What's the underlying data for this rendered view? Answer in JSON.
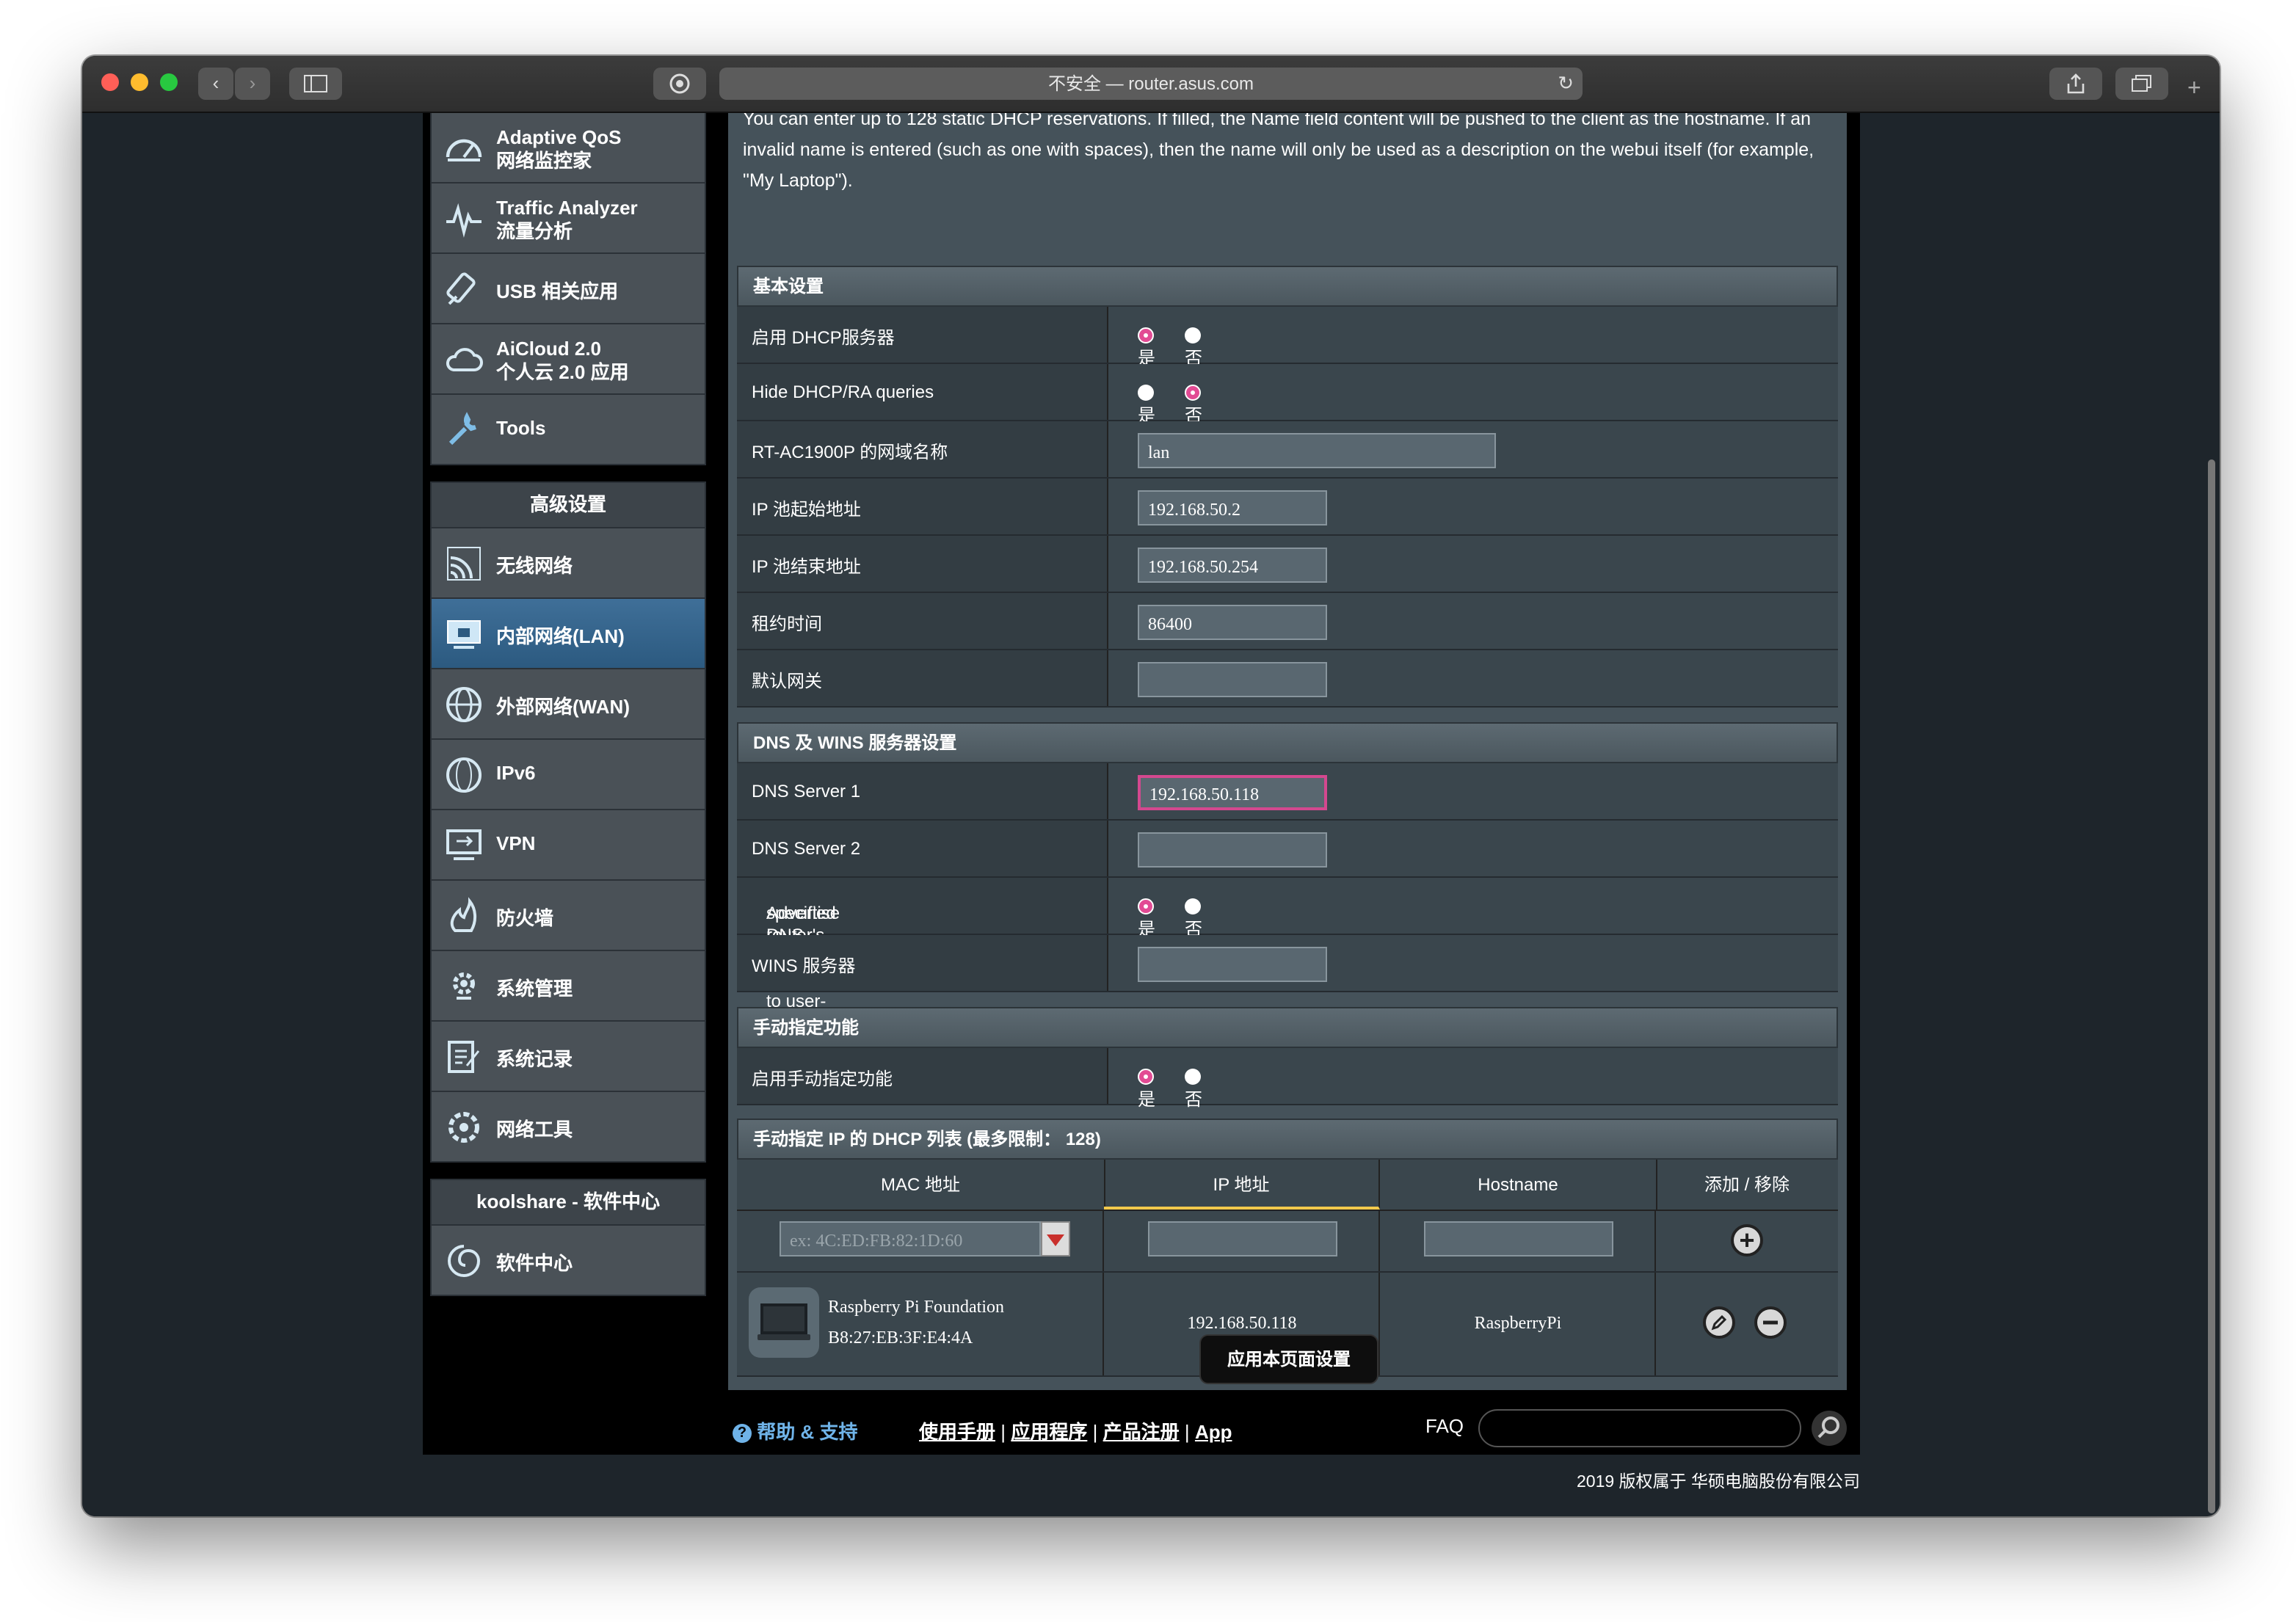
{
  "browser": {
    "url_text": "不安全 — router.asus.com",
    "reload_glyph": "↻"
  },
  "sidebar": {
    "general_items": [
      {
        "label_1": "Adaptive QoS",
        "label_2": "网络监控家",
        "icon": "gauge-icon"
      },
      {
        "label_1": "Traffic Analyzer",
        "label_2": "流量分析",
        "icon": "pulse-icon"
      },
      {
        "label_1": "USB 相关应用",
        "label_2": "",
        "icon": "usb-icon"
      },
      {
        "label_1": "AiCloud 2.0",
        "label_2": "个人云 2.0 应用",
        "icon": "cloud-icon"
      },
      {
        "label_1": "Tools",
        "label_2": "",
        "icon": "wrench-icon"
      }
    ],
    "advanced_header": "高级设置",
    "advanced_items": [
      {
        "label": "无线网络",
        "icon": "wifi-icon",
        "active": false
      },
      {
        "label": "内部网络(LAN)",
        "icon": "lan-icon",
        "active": true
      },
      {
        "label": "外部网络(WAN)",
        "icon": "globe-icon",
        "active": false
      },
      {
        "label": "IPv6",
        "icon": "ipv6-icon",
        "active": false
      },
      {
        "label": "VPN",
        "icon": "vpn-icon",
        "active": false
      },
      {
        "label": "防火墙",
        "icon": "firewall-icon",
        "active": false
      },
      {
        "label": "系统管理",
        "icon": "gear-icon",
        "active": false
      },
      {
        "label": "系统记录",
        "icon": "log-icon",
        "active": false
      },
      {
        "label": "网络工具",
        "icon": "tools-icon",
        "active": false
      }
    ],
    "koolshare_header": "koolshare - 软件中心",
    "koolshare_item": {
      "label": "软件中心",
      "icon": "swirl-icon"
    }
  },
  "intro_text": "You can enter up to 128 static DHCP reservations. If filled, the Name field content will be pushed to the client as the hostname. If an invalid name is entered (such as one with spaces), then the name will only be used as a description on the webui itself (for example, \"My Laptop\").",
  "basic": {
    "header": "基本设置",
    "enable_dhcp": {
      "label": "启用 DHCP服务器",
      "yes": "是",
      "no": "否",
      "value": "yes"
    },
    "hide_dhcp": {
      "label": "Hide DHCP/RA queries",
      "yes": "是",
      "no": "否",
      "value": "no"
    },
    "domain_name": {
      "label": "RT-AC1900P 的网域名称",
      "value": "lan"
    },
    "ip_start": {
      "label": "IP 池起始地址",
      "value": "192.168.50.2"
    },
    "ip_end": {
      "label": "IP 池结束地址",
      "value": "192.168.50.254"
    },
    "lease": {
      "label": "租约时间",
      "value": "86400"
    },
    "gateway": {
      "label": "默认网关",
      "value": ""
    }
  },
  "dns": {
    "header": "DNS 及 WINS 服务器设置",
    "dns1": {
      "label": "DNS Server 1",
      "value": "192.168.50.118"
    },
    "dns2": {
      "label": "DNS Server 2",
      "value": ""
    },
    "advertise": {
      "label_1": "Advertise router's IP in addition to user-",
      "label_2": "specified DNS",
      "yes": "是",
      "no": "否",
      "value": "yes"
    },
    "wins": {
      "label": "WINS 服务器",
      "value": ""
    }
  },
  "manual": {
    "header": "手动指定功能",
    "enable": {
      "label": "启用手动指定功能",
      "yes": "是",
      "no": "否",
      "value": "yes"
    }
  },
  "dhcp_list": {
    "header": "手动指定 IP 的 DHCP 列表 (最多限制： 128)",
    "columns": [
      "MAC 地址",
      "IP 地址",
      "Hostname",
      "添加 / 移除"
    ],
    "mac_placeholder": "ex: 4C:ED:FB:82:1D:60",
    "rows": [
      {
        "vendor": "Raspberry Pi Foundation",
        "mac": "B8:27:EB:3F:E4:4A",
        "ip": "192.168.50.118",
        "hostname": "RaspberryPi"
      }
    ]
  },
  "apply_label": "应用本页面设置",
  "footer": {
    "help": "帮助 & 支持",
    "links": [
      "使用手册",
      "应用程序",
      "产品注册",
      "App"
    ],
    "separator": "|",
    "faq": "FAQ",
    "copyright": "2019 版权属于 华硕电脑股份有限公司"
  },
  "colors": {
    "accent": "#e24b94",
    "active_nav": "#3f6f98",
    "tab_underline": "#f2c94c"
  }
}
